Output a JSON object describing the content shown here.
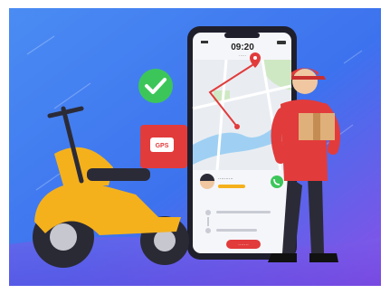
{
  "phone": {
    "clock": "09:20",
    "date_line": "·····",
    "driver_name": "··········",
    "button_label": "·······"
  },
  "scooter": {
    "box_logo": "GPS"
  },
  "icons": {
    "check": "check-badge-icon",
    "call": "phone-call-icon",
    "pin": "map-pin-icon"
  },
  "colors": {
    "background": "#3f86f0",
    "accent_red": "#e23b3b",
    "scooter_yellow": "#f5b11c",
    "check_green": "#3cc65a"
  }
}
